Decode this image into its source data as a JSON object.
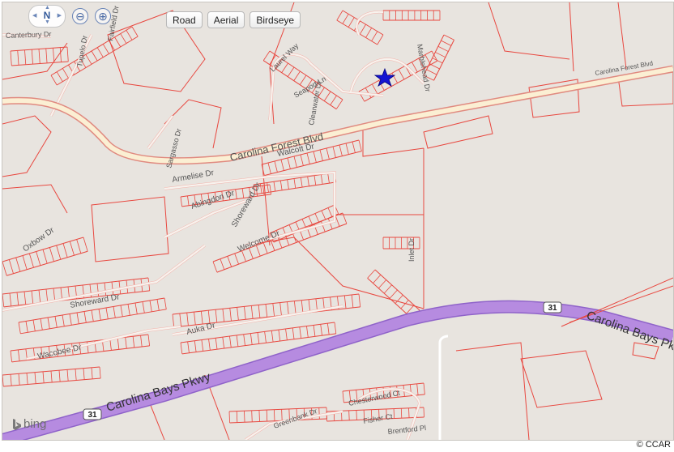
{
  "controls": {
    "compass_label": "N",
    "zoom_out_symbol": "⊖",
    "zoom_in_symbol": "⊕",
    "view_buttons": [
      "Road",
      "Aerial",
      "Birdseye"
    ]
  },
  "branding": {
    "bing_text": "bing"
  },
  "credit": "© CCAR",
  "roads": {
    "carolina_forest_blvd": "Carolina Forest Blvd",
    "carolina_forest_blvd_small": "Carolina Forest Blvd",
    "carolina_bays_pkwy": "Carolina Bays Pkwy",
    "carolina_bays_pkwy_east": "Carolina Bays Pk",
    "route_shield": "31",
    "walcott": "Walcott Dr",
    "armelise": "Armelise Dr",
    "abingdon": "Abingdon Dr",
    "shoreward": "Shoreward Dr",
    "shoreward_west": "Shoreward Dr",
    "welcome": "Welcome Dr",
    "oxbow": "Oxbow Dr",
    "wacobee": "Wacobee Dr",
    "auka": "Auka Dr",
    "seaport": "Seaport Ln",
    "laurel_way": "Laurel Way",
    "sargasso": "Sargasso Dr",
    "inlet": "Inlet Dr",
    "chesterwood": "Chesterwood Ct",
    "fisher": "Fisher Ct",
    "brentford": "Brentford Pl",
    "greenbank": "Greenbank Dr",
    "tupelo": "Tupelo Dr",
    "fairfield": "Fairfield Dr",
    "marblehead": "Marblehead Dr",
    "canterbury": "Canterbury Dr",
    "clearwater": "Clearwater Dr"
  },
  "marker": {
    "type": "star",
    "color": "#1414d2"
  },
  "colors": {
    "parcel": "#e8473f",
    "highway": "#b68be0",
    "arterial": "#fbefd3",
    "background": "#e8e4df"
  }
}
